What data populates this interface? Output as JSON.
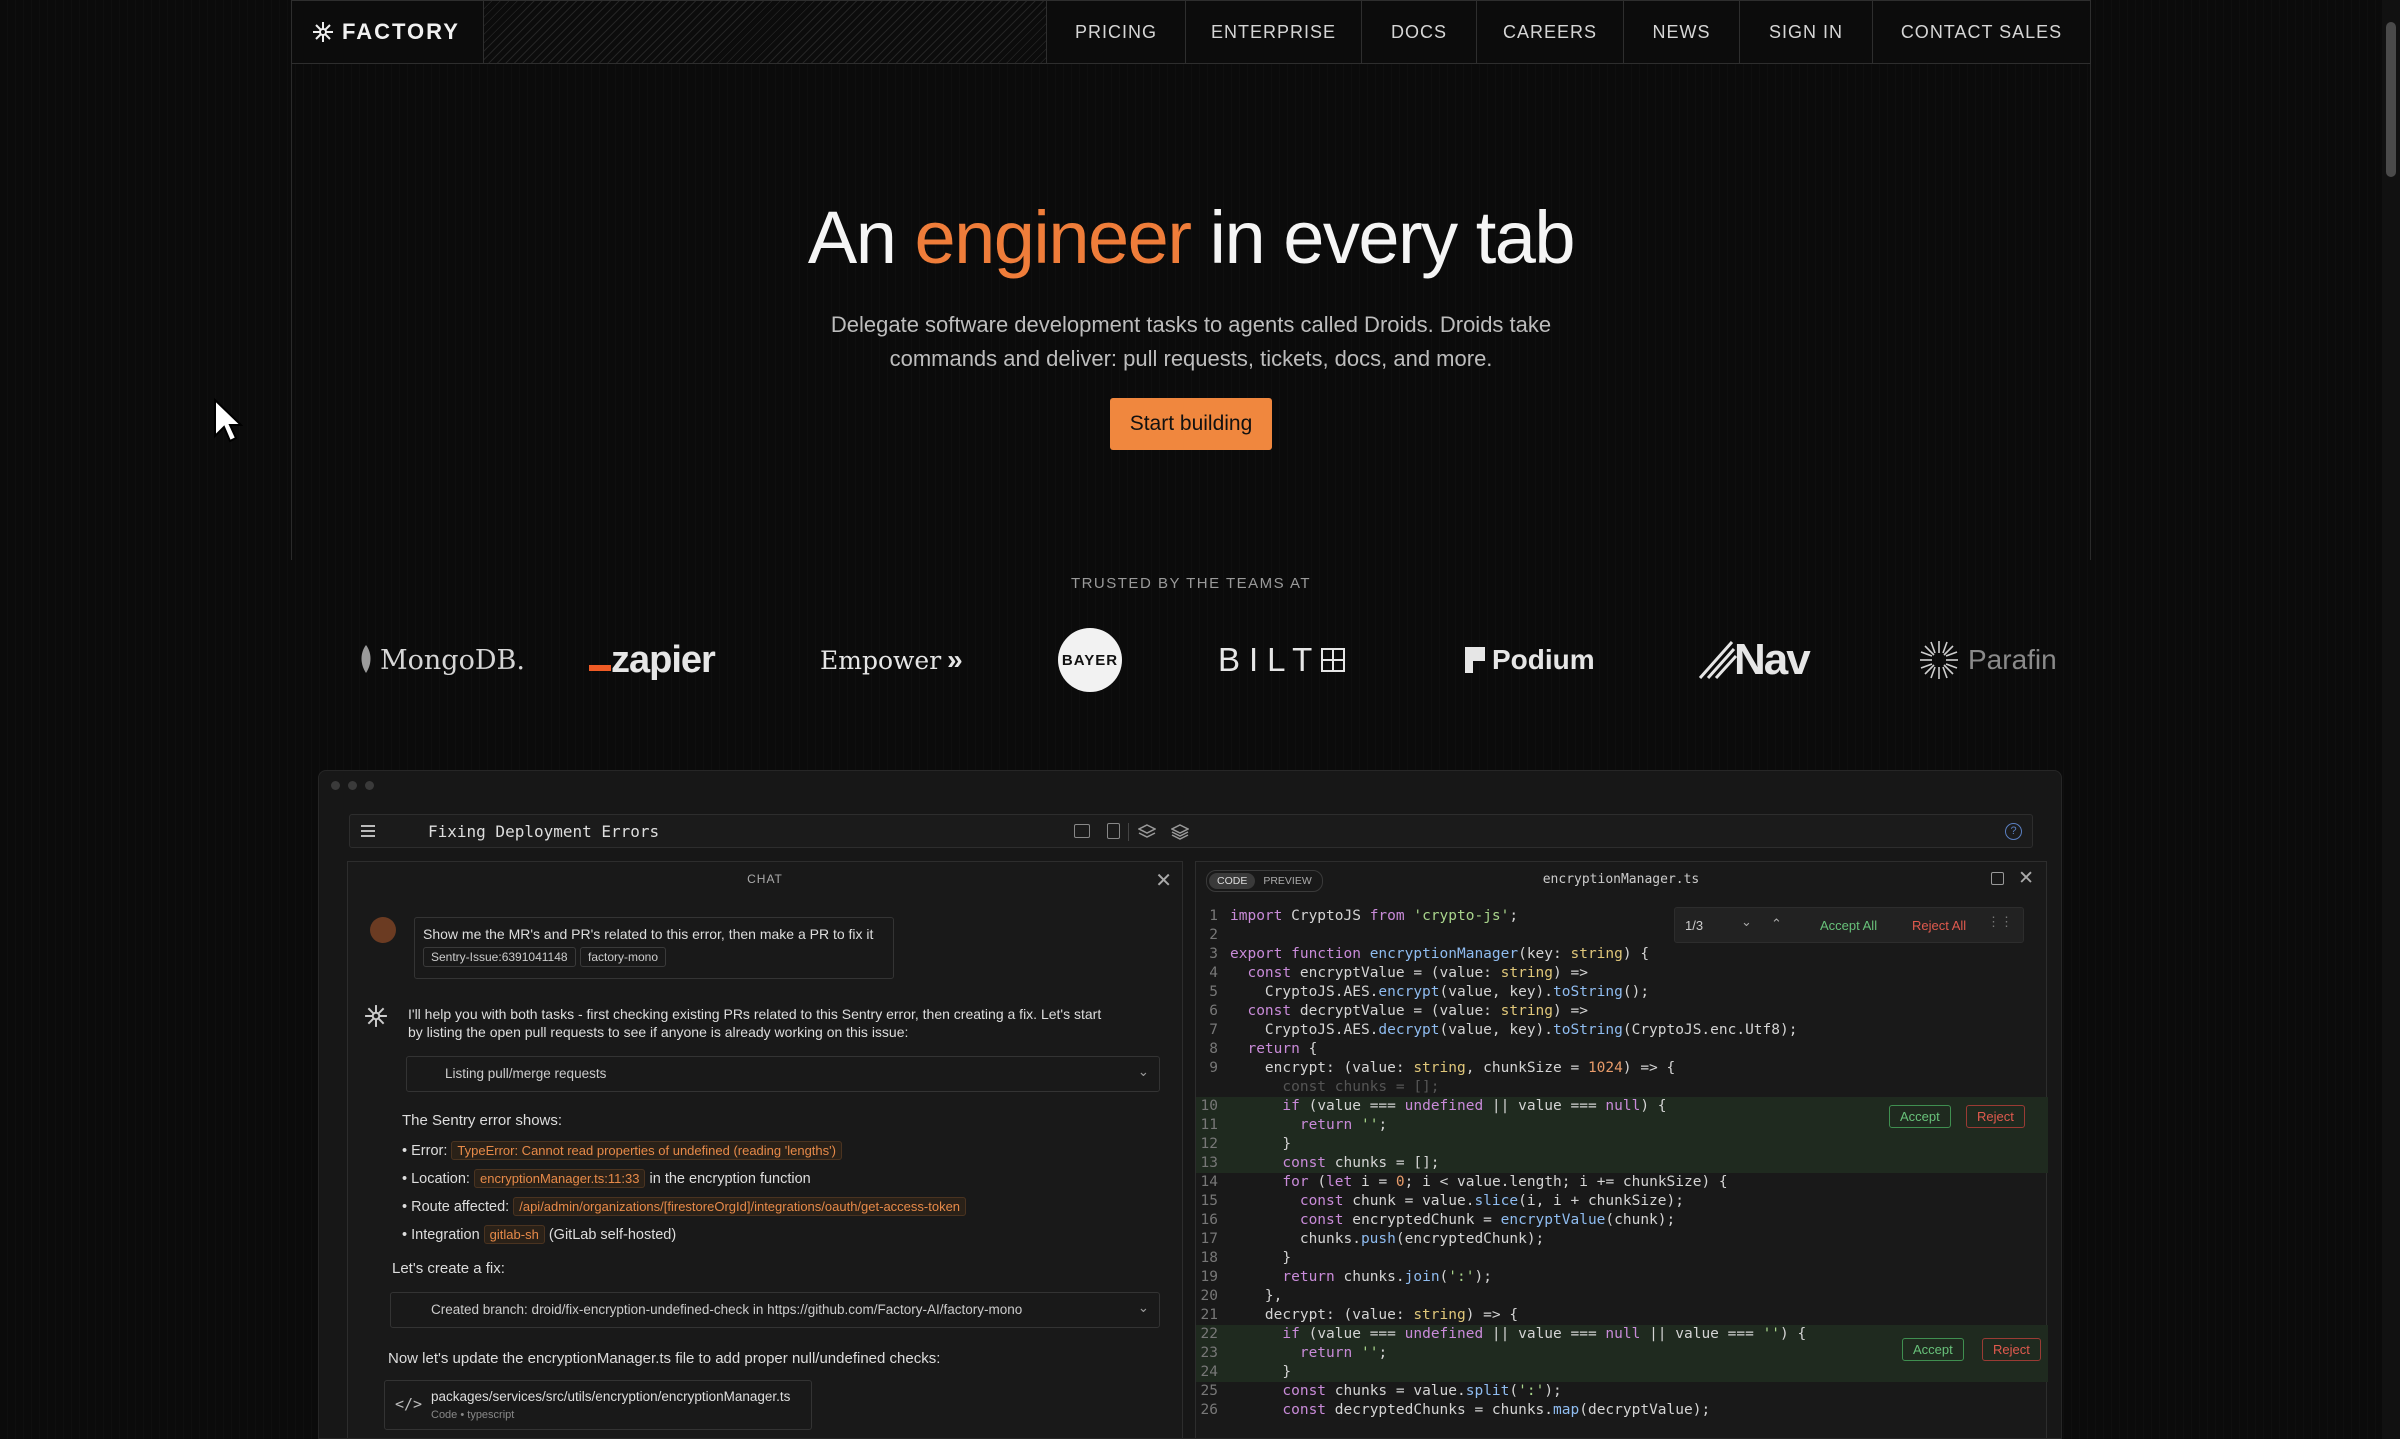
{
  "nav": {
    "brand": "FACTORY",
    "items": [
      "PRICING",
      "ENTERPRISE",
      "DOCS",
      "CAREERS",
      "NEWS",
      "SIGN IN",
      "CONTACT SALES"
    ]
  },
  "hero": {
    "title_pre": "An",
    "title_accent": "engineer",
    "title_post": "in every tab",
    "subtitle": "Delegate software development tasks to agents called Droids. Droids take commands and deliver: pull requests, tickets, docs, and more.",
    "cta": "Start building",
    "accent_color": "#ef7d3a"
  },
  "trusted": {
    "label": "TRUSTED BY THE TEAMS AT",
    "logos": [
      "MongoDB.",
      "zapier",
      "Empower",
      "BAYER",
      "BILT",
      "Podium",
      "Nav",
      "Parafin"
    ]
  },
  "app": {
    "title": "Fixing Deployment Errors",
    "chat": {
      "header": "CHAT",
      "user_msg": "Show me the MR's and PR's related to this error, then make a PR to fix it",
      "user_chips": [
        "Sentry-Issue:6391041148",
        "factory-mono"
      ],
      "reply": "I'll help you with both tasks - first checking existing PRs related to this Sentry error, then creating a fix. Let's start by listing the open pull requests to see if anyone is already working on this issue:",
      "tool1": "Listing pull/merge requests",
      "sentry_heading": "The Sentry error shows:",
      "bullets": [
        {
          "label": "Error:",
          "tag": "TypeError: Cannot read properties of undefined (reading 'lengths')",
          "after": ""
        },
        {
          "label": "Location:",
          "tag": "encryptionManager.ts:11:33",
          "after": "in the encryption function"
        },
        {
          "label": "Route affected:",
          "tag": "/api/admin/organizations/[firestoreOrgId]/integrations/oauth/get-access-token",
          "after": ""
        },
        {
          "label": "Integration",
          "tag": "gitlab-sh",
          "after": "(GitLab self-hosted)"
        }
      ],
      "fix_heading": "Let's create a fix:",
      "tool2": "Created branch: droid/fix-encryption-undefined-check in https://github.com/Factory-AI/factory-mono",
      "update_text": "Now let's update the encryptionManager.ts file to add proper null/undefined checks:",
      "file_path": "packages/services/src/utils/encryption/encryptionManager.ts",
      "file_meta": "Code • typescript"
    },
    "code": {
      "tabs": [
        "CODE",
        "PREVIEW"
      ],
      "filename": "encryptionManager.ts",
      "diff_counter": "1/3",
      "accept_all": "Accept All",
      "reject_all": "Reject All",
      "accept": "Accept",
      "reject": "Reject"
    }
  }
}
